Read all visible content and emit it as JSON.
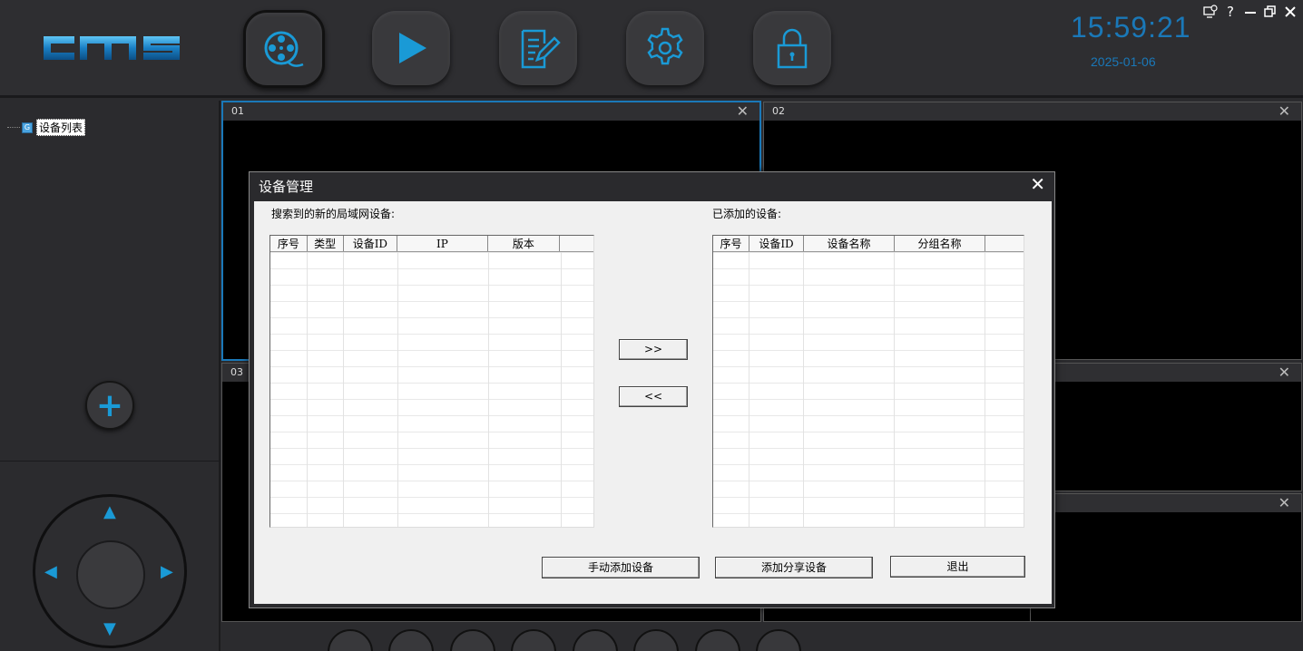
{
  "header": {
    "logo_text": "cms",
    "clock": "15:59:21",
    "date": "2025-01-06",
    "nav": [
      {
        "icon": "film-reel-icon",
        "active": true
      },
      {
        "icon": "play-icon",
        "active": false
      },
      {
        "icon": "edit-document-icon",
        "active": false
      },
      {
        "icon": "gear-icon",
        "active": false
      },
      {
        "icon": "lock-icon",
        "active": false
      }
    ],
    "window_controls": [
      "monitor-icon",
      "help-icon",
      "minimize-icon",
      "restore-icon",
      "close-icon"
    ],
    "help_glyph": "?",
    "accent": "#1a9ad6"
  },
  "sidebar": {
    "tree_root_icon": "G",
    "tree_root_label": "设备列表",
    "add_glyph": "+"
  },
  "video_windows": [
    {
      "title": "01",
      "selected": true
    },
    {
      "title": "02",
      "selected": false
    },
    {
      "title": "03",
      "selected": false
    },
    {
      "title": "",
      "selected": false
    },
    {
      "title": "",
      "selected": false
    }
  ],
  "dialog": {
    "title": "设备管理",
    "close_glyph": "✕",
    "search_section_label": "搜索到的新的局域网设备:",
    "search_columns": [
      "序号",
      "类型",
      "设备ID",
      "IP",
      "版本",
      ""
    ],
    "added_section_label": "已添加的设备:",
    "added_columns": [
      "序号",
      "设备ID",
      "设备名称",
      "分组名称",
      ""
    ],
    "add_arrow_label": ">>",
    "remove_arrow_label": "<<",
    "manual_add_label": "手动添加设备",
    "add_shared_label": "添加分享设备",
    "exit_label": "退出"
  }
}
